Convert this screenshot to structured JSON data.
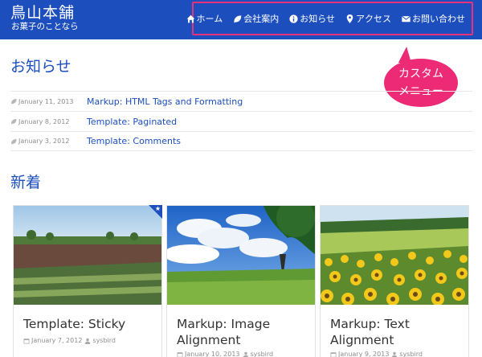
{
  "site": {
    "title": "鳥山本舗",
    "tagline": "お菓子のことなら"
  },
  "nav": {
    "items": [
      {
        "label": "ホーム",
        "icon": "home-icon"
      },
      {
        "label": "会社案内",
        "icon": "leaf-icon"
      },
      {
        "label": "お知らせ",
        "icon": "info-icon"
      },
      {
        "label": "アクセス",
        "icon": "map-marker-icon"
      },
      {
        "label": "お問い合わせ",
        "icon": "envelope-icon"
      }
    ]
  },
  "callout": {
    "line1": "カスタム",
    "line2": "メニュー"
  },
  "news": {
    "heading": "お知らせ",
    "items": [
      {
        "date": "January 11, 2013",
        "title": "Markup: HTML Tags and Formatting"
      },
      {
        "date": "January 8, 2012",
        "title": "Template: Paginated"
      },
      {
        "date": "January 3, 2012",
        "title": "Template: Comments"
      }
    ]
  },
  "new_posts": {
    "heading": "新着",
    "cards": [
      {
        "title": "Template: Sticky",
        "date": "January 7, 2012",
        "author": "sysbird",
        "sticky_icon": "star-icon"
      },
      {
        "title": "Markup: Image Alignment",
        "date": "January 10, 2013",
        "author": "sysbird"
      },
      {
        "title": "Markup: Text Alignment",
        "date": "January 9, 2013",
        "author": "sysbird"
      }
    ]
  },
  "colors": {
    "header_bg": "#1c4fbd",
    "accent_pink": "#ec2a76",
    "link_blue": "#1c4fbd"
  }
}
